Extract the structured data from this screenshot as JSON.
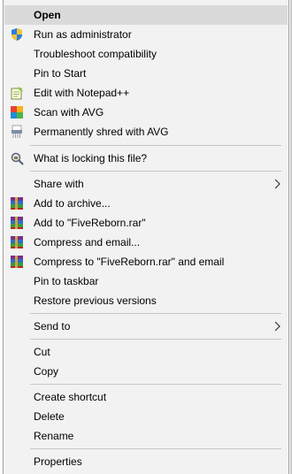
{
  "menu": {
    "open": "Open",
    "run_as_admin": "Run as administrator",
    "troubleshoot": "Troubleshoot compatibility",
    "pin_start": "Pin to Start",
    "edit_notepad": "Edit with Notepad++",
    "scan_avg": "Scan with AVG",
    "shred_avg": "Permanently shred with AVG",
    "what_locking": "What is locking this file?",
    "share_with": "Share with",
    "add_archive": "Add to archive...",
    "add_to_rar": "Add to \"FiveReborn.rar\"",
    "compress_email": "Compress and email...",
    "compress_rar_email": "Compress to \"FiveReborn.rar\" and email",
    "pin_taskbar": "Pin to taskbar",
    "restore_versions": "Restore previous versions",
    "send_to": "Send to",
    "cut": "Cut",
    "copy": "Copy",
    "create_shortcut": "Create shortcut",
    "delete": "Delete",
    "rename": "Rename",
    "properties": "Properties"
  },
  "colors": {
    "menu_bg": "#f2f2f2",
    "highlight": "#dadada",
    "separator": "#c6c6c6"
  },
  "icons": {
    "run_as_admin": "uac-shield-icon",
    "edit_notepad": "notepad-plus-plus-icon",
    "scan_avg": "avg-icon",
    "shred_avg": "avg-shredder-icon",
    "what_locking": "lock-hunter-icon",
    "winrar": "winrar-books-icon",
    "submenu": "chevron-right-icon"
  }
}
